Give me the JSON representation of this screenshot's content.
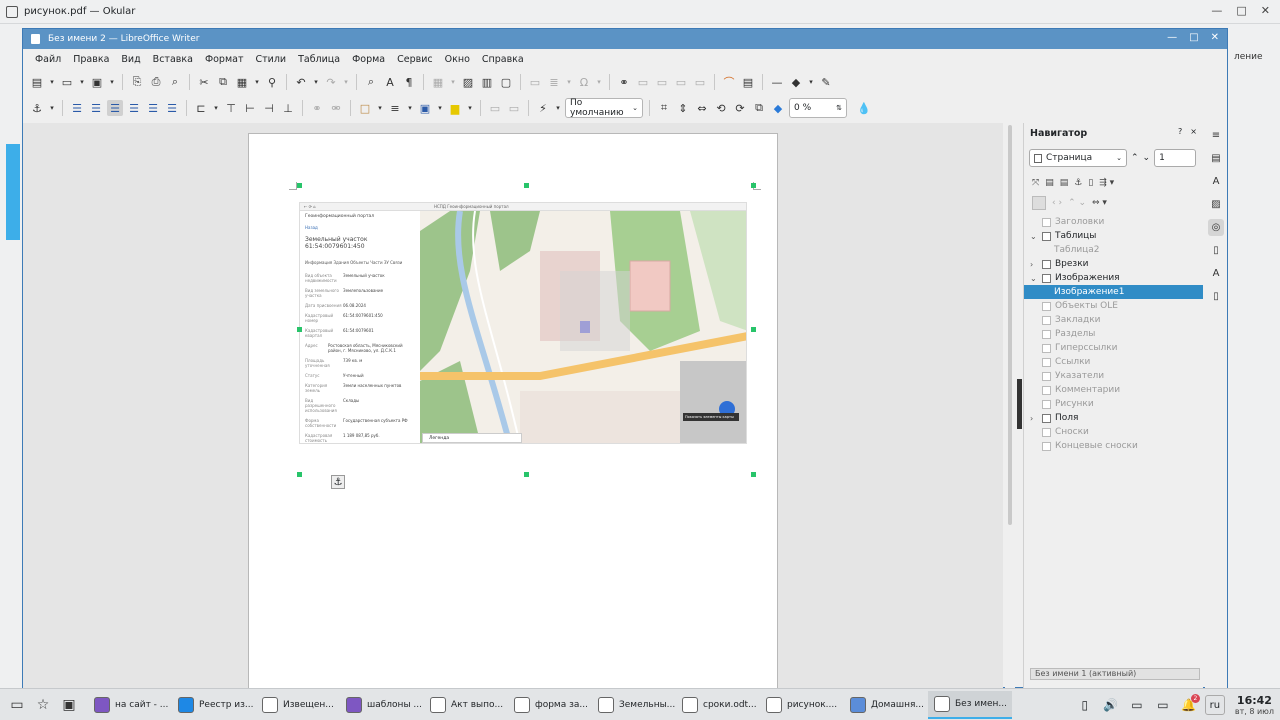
{
  "okular": {
    "title": "рисунок.pdf — Okular",
    "right_label": "ление"
  },
  "writer": {
    "title": "Без имени 2 — LibreOffice Writer",
    "menu": [
      "Файл",
      "Правка",
      "Вид",
      "Вставка",
      "Формат",
      "Стили",
      "Таблица",
      "Форма",
      "Сервис",
      "Окно",
      "Справка"
    ],
    "frame_style": "По умолчанию",
    "transparency": "0 %"
  },
  "embedded": {
    "browser_title": "НСПД Геоинформационный портал",
    "portal": "Геоинформационный портал",
    "back": "Назад",
    "heading": "Земельный участок 61:54:0079601:450",
    "tabs": "Информация  Здания  Объекты  Части ЗУ  Связи",
    "fields": [
      {
        "k": "Вид объекта недвижимости",
        "v": "Земельный участок"
      },
      {
        "k": "Вид земельного участка",
        "v": "Землепользование"
      },
      {
        "k": "Дата присвоения",
        "v": "06.08.2024"
      },
      {
        "k": "Кадастровый номер",
        "v": "61:54:0079601:450"
      },
      {
        "k": "Кадастровый квартал",
        "v": "61:54:0079601"
      },
      {
        "k": "Адрес",
        "v": "Ростовская область, Мясниковский район, г. Мясниково, ул. Д.С.К.1"
      },
      {
        "k": "Площадь уточненная",
        "v": "739 кв. м"
      },
      {
        "k": "Статус",
        "v": "Учтенный"
      },
      {
        "k": "Категория земель",
        "v": "Земли населенных пунктов"
      },
      {
        "k": "Вид разрешенного использования",
        "v": "Склады"
      },
      {
        "k": "Форма собственности",
        "v": "Государственная субъекта РФ"
      },
      {
        "k": "Кадастровая стоимость",
        "v": "1 189 087,85 руб."
      }
    ],
    "legend": "Легенда",
    "tooltip": "Показать элементы карты"
  },
  "navigator": {
    "title": "Навигатор",
    "help": "?",
    "close": "×",
    "category": "Страница",
    "page_num": "1",
    "tree": [
      {
        "label": "Заголовки",
        "dim": true,
        "arrow": "",
        "level": 0
      },
      {
        "label": "Таблицы",
        "dim": false,
        "arrow": "⌄",
        "level": 0
      },
      {
        "label": "Таблица2",
        "dim": true,
        "arrow": "",
        "level": 1
      },
      {
        "label": "Врезки",
        "dim": false,
        "arrow": "›",
        "level": 0
      },
      {
        "label": "Изображения",
        "dim": false,
        "arrow": "⌄",
        "level": 0
      },
      {
        "label": "Изображение1",
        "dim": false,
        "arrow": "",
        "level": 1,
        "selected": true
      },
      {
        "label": "Объекты OLE",
        "dim": true,
        "arrow": "",
        "level": 0
      },
      {
        "label": "Закладки",
        "dim": true,
        "arrow": "",
        "level": 0
      },
      {
        "label": "Разделы",
        "dim": true,
        "arrow": "",
        "level": 0
      },
      {
        "label": "Гиперссылки",
        "dim": true,
        "arrow": "",
        "level": 0
      },
      {
        "label": "Ссылки",
        "dim": true,
        "arrow": "",
        "level": 0
      },
      {
        "label": "Указатели",
        "dim": true,
        "arrow": "",
        "level": 0
      },
      {
        "label": "Комментарии",
        "dim": true,
        "arrow": "",
        "level": 0
      },
      {
        "label": "Рисунки",
        "dim": true,
        "arrow": "",
        "level": 0
      },
      {
        "label": "Поля",
        "dim": false,
        "arrow": "›",
        "level": 0
      },
      {
        "label": "Сноски",
        "dim": true,
        "arrow": "",
        "level": 0
      },
      {
        "label": "Концевые сноски",
        "dim": true,
        "arrow": "",
        "level": 0
      }
    ],
    "doc_select": "Без имени 1 (активный)"
  },
  "taskbar": {
    "tasks": [
      {
        "label": "на сайт - ...",
        "color": "#7e57c2"
      },
      {
        "label": "Реестр из...",
        "color": "#1e88e5"
      },
      {
        "label": "Извещен...",
        "color": "#ffffff"
      },
      {
        "label": "шаблоны ...",
        "color": "#7e57c2"
      },
      {
        "label": "Акт выпо...",
        "color": "#ffffff"
      },
      {
        "label": "форма за...",
        "color": "#ffffff"
      },
      {
        "label": "Земельны...",
        "color": "#ffffff"
      },
      {
        "label": "сроки.odt...",
        "color": "#ffffff"
      },
      {
        "label": "рисунок....",
        "color": "#ffffff"
      },
      {
        "label": "Домашня...",
        "color": "#5b8dd9"
      },
      {
        "label": "Без имен...",
        "color": "#ffffff"
      }
    ],
    "notif_count": "2",
    "lang": "ru",
    "time": "16:42",
    "date": "вт, 8 июл"
  }
}
